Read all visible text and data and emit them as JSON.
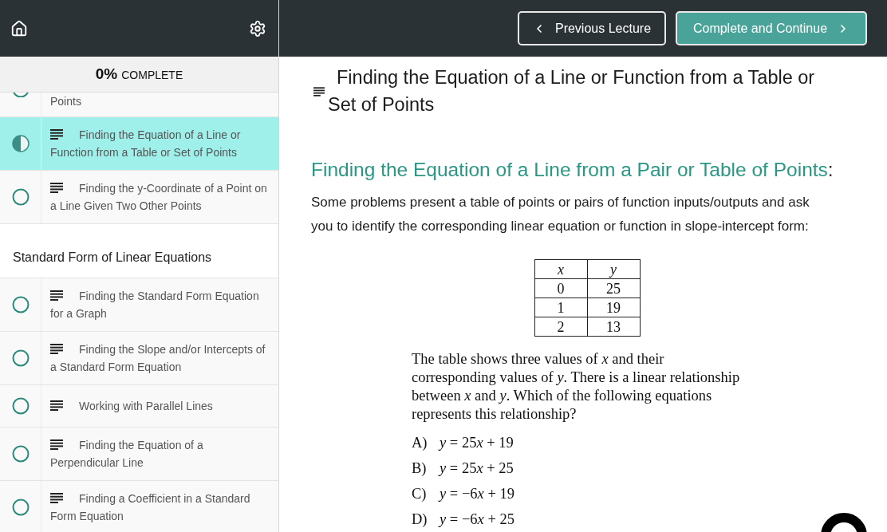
{
  "sidebar": {
    "progress": {
      "percent": "0%",
      "label": "COMPLETE"
    },
    "sections": [
      {
        "lessons": [
          {
            "title": "Points",
            "in_progress": false,
            "selected": false,
            "clipped": true
          },
          {
            "title": "Finding the Equation of a Line or Function from a Table or Set of Points",
            "in_progress": true,
            "selected": true,
            "clipped": false
          },
          {
            "title": "Finding the y-Coordinate of a Point on a Line Given Two Other Points",
            "in_progress": false,
            "selected": false,
            "clipped": false
          }
        ]
      },
      {
        "title": "Standard Form of Linear Equations",
        "lessons": [
          {
            "title": "Finding the Standard Form Equation for a Graph",
            "in_progress": false,
            "selected": false,
            "clipped": false
          },
          {
            "title": "Finding the Slope and/or Intercepts of a Standard Form Equation",
            "in_progress": false,
            "selected": false,
            "clipped": false
          },
          {
            "title": "Working with Parallel Lines",
            "in_progress": false,
            "selected": false,
            "clipped": false
          },
          {
            "title": "Finding the Equation of a Perpendicular Line",
            "in_progress": false,
            "selected": false,
            "clipped": false
          },
          {
            "title": "Finding a Coefficient in a Standard Form Equation",
            "in_progress": false,
            "selected": false,
            "clipped": false
          }
        ]
      }
    ]
  },
  "topbar": {
    "buttons": [
      {
        "label": "Previous Lecture",
        "kind": "previous"
      },
      {
        "label": "Complete and Continue",
        "kind": "next"
      }
    ]
  },
  "lecture": {
    "title": "Finding the Equation of a Line or Function from a Table or Set of Points",
    "heading": {
      "text": "Finding the Equation of a Line from a Pair or Table of Points",
      "suffix": ":"
    },
    "paragraph": "Some problems present a table of points or pairs of function inputs/outputs and ask you to identify the corresponding linear equation or function in slope-intercept form:",
    "table": {
      "columns": [
        "x",
        "y"
      ],
      "rows": [
        [
          "0",
          "25"
        ],
        [
          "1",
          "19"
        ],
        [
          "2",
          "13"
        ]
      ]
    },
    "question": "The table shows three values of *x* and their corresponding values of *y*. There is a linear relationship between *x* and *y*. Which of the following equations represents this relationship?",
    "options": [
      {
        "letter": "A)",
        "equation": [
          {
            "text": "y",
            "italic": true
          },
          {
            "text": " = 25",
            "italic": false
          },
          {
            "text": "x",
            "italic": true
          },
          {
            "text": " + 19",
            "italic": false
          }
        ]
      },
      {
        "letter": "B)",
        "equation": [
          {
            "text": "y",
            "italic": true
          },
          {
            "text": " = 25",
            "italic": false
          },
          {
            "text": "x",
            "italic": true
          },
          {
            "text": " + 25",
            "italic": false
          }
        ]
      },
      {
        "letter": "C)",
        "equation": [
          {
            "text": "y",
            "italic": true
          },
          {
            "text": " = −6",
            "italic": false
          },
          {
            "text": "x",
            "italic": true
          },
          {
            "text": " + 19",
            "italic": false
          }
        ]
      },
      {
        "letter": "D)",
        "equation": [
          {
            "text": "y",
            "italic": true
          },
          {
            "text": " = −6",
            "italic": false
          },
          {
            "text": "x",
            "italic": true
          },
          {
            "text": " + 25",
            "italic": false
          }
        ]
      }
    ]
  }
}
